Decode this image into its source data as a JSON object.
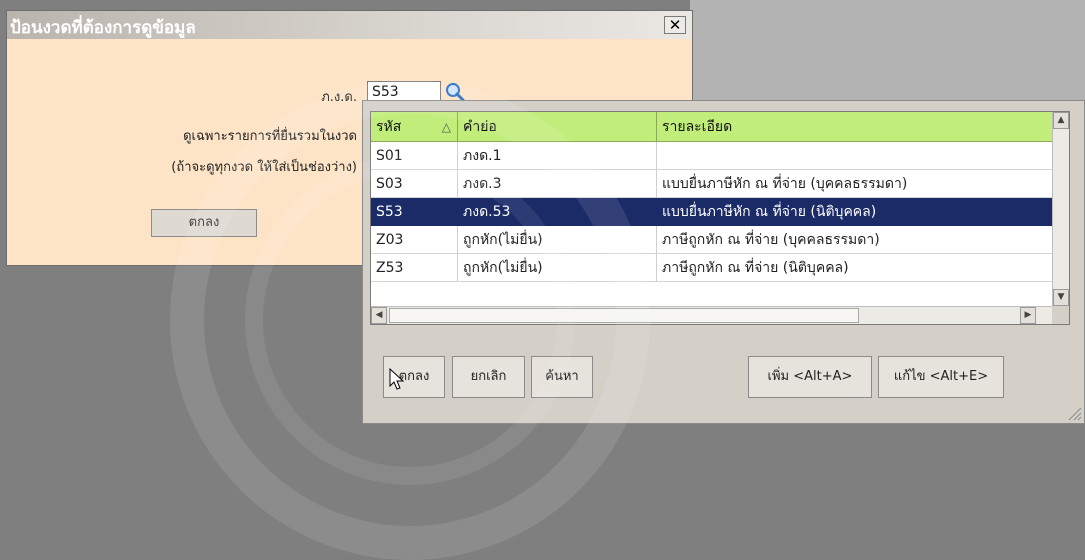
{
  "period_dialog": {
    "title": "ป้อนงวดที่ต้องการดูข้อมูล",
    "close_glyph": "✕",
    "form_label": "ภ.ง.ด.",
    "form_value": "S53",
    "note_line1": "ดูเฉพาะรายการที่ยื่นรวมในงวด",
    "note_line2": "(ถ้าจะดูทุกงวด ให้ใส่เป็นช่องว่าง)",
    "ok_label": "ตกลง"
  },
  "lookup": {
    "columns": [
      "รหัส",
      "คำย่อ",
      "รายละเอียด"
    ],
    "sort_glyph": "△",
    "rows": [
      {
        "code": "S01",
        "abbr": "ภงด.1",
        "desc": "",
        "selected": false
      },
      {
        "code": "S03",
        "abbr": "ภงด.3",
        "desc": "แบบยื่นภาษีหัก ณ ที่จ่าย (บุคคลธรรมดา)",
        "selected": false
      },
      {
        "code": "S53",
        "abbr": "ภงด.53",
        "desc": "แบบยื่นภาษีหัก ณ ที่จ่าย (นิติบุคคล)",
        "selected": true
      },
      {
        "code": "Z03",
        "abbr": "ถูกหัก(ไม่ยื่น)",
        "desc": "ภาษีถูกหัก ณ ที่จ่าย (บุคคลธรรมดา)",
        "selected": false
      },
      {
        "code": "Z53",
        "abbr": "ถูกหัก(ไม่ยื่น)",
        "desc": "ภาษีถูกหัก ณ ที่จ่าย (นิติบุคคล)",
        "selected": false
      }
    ],
    "buttons": {
      "ok": "ตกลง",
      "cancel": "ยกเลิก",
      "search": "ค้นหา",
      "add": "เพิ่ม <Alt+A>",
      "edit": "แก้ไข <Alt+E>"
    },
    "scroll_glyphs": {
      "up": "▲",
      "down": "▼",
      "left": "◀",
      "right": "▶"
    }
  },
  "colors": {
    "dialog_bg": "#fde4c7",
    "grid_header": "#c1ed7a",
    "selected_row": "#1b2b68",
    "face": "#d4d0c8"
  },
  "icons": [
    "search-icon",
    "close-icon",
    "sort-ascending-icon",
    "mouse-cursor-icon",
    "resize-grip-icon"
  ]
}
